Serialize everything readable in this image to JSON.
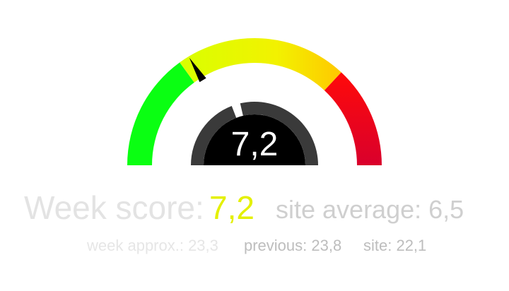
{
  "gauge": {
    "value": 7.2,
    "min": 0,
    "max": 20,
    "display_value": "7,2",
    "inner_progress": 0.95,
    "colors": {
      "green": "#0aff12",
      "yellow": "#e9ff00",
      "orange": "#ffcc00",
      "red": "#ff0a10",
      "dark_red": "#d90029",
      "inner_ring": "#3a3a3a",
      "inner_disc": "#000000",
      "needle": "#000000"
    }
  },
  "score": {
    "label": "Week score:",
    "value": "7,2",
    "site_average": "site average: 6,5"
  },
  "stats": {
    "week_approx": "week approx.: 23,3",
    "previous": "previous: 23,8",
    "site": "site: 22,1"
  }
}
